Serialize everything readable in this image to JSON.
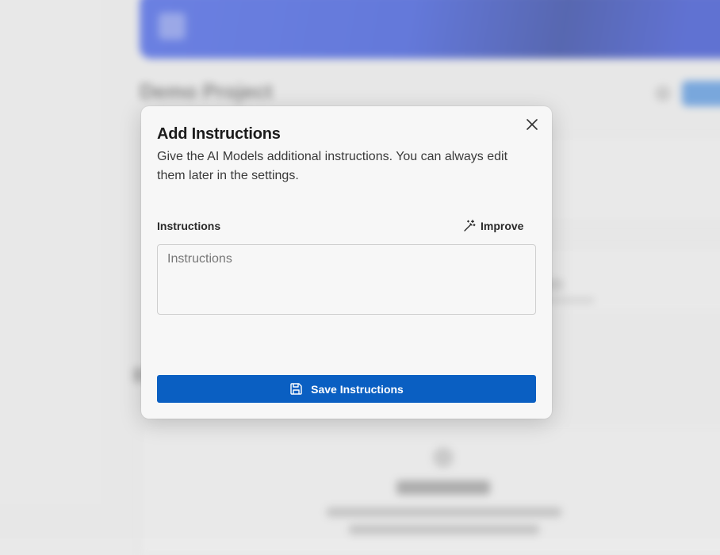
{
  "background": {
    "project_title": "Demo Project",
    "empty_state_title": "Guidelines"
  },
  "modal": {
    "title": "Add Instructions",
    "description": "Give the AI Models additional instructions. You can always edit them later in the settings.",
    "field_label": "Instructions",
    "improve_label": "Improve",
    "input_placeholder": "Instructions",
    "input_value": "",
    "save_label": "Save Instructions",
    "icons": {
      "close": "close-icon",
      "improve": "magic-wand-icon",
      "save": "save-icon"
    }
  },
  "colors": {
    "primary_button": "#0a5fc2",
    "banner_blue": "#1f3fd4",
    "modal_background": "#f7f7f7"
  }
}
